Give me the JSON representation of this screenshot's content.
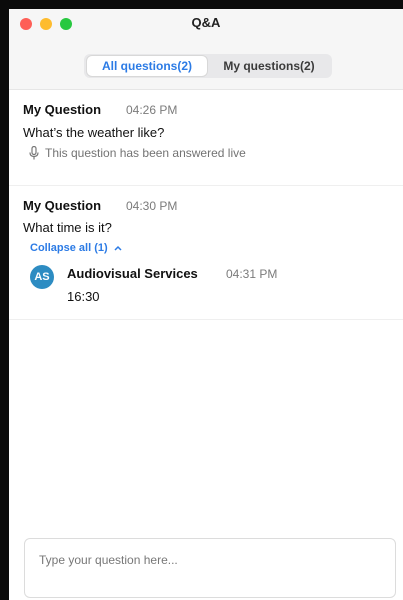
{
  "window": {
    "title": "Q&A"
  },
  "tabs": {
    "all": "All questions(2)",
    "mine": "My questions(2)"
  },
  "questions": [
    {
      "author": "My Question",
      "time": "04:26 PM",
      "text": "What’s the weather like?",
      "status": "This question has been answered live",
      "status_icon": "microphone-icon"
    },
    {
      "author": "My Question",
      "time": "04:30 PM",
      "text": "What time is it?",
      "collapse_label": "Collapse all (1)",
      "answer": {
        "avatar_initials": "AS",
        "responder": "Audiovisual Services",
        "time": "04:31 PM",
        "text": "16:30"
      }
    }
  ],
  "input": {
    "placeholder": "Type your question here..."
  },
  "colors": {
    "accent": "#2c7be5",
    "avatar": "#2d8cc2",
    "close": "#fe5f57",
    "minimize": "#febc2e",
    "maximize": "#28c840"
  }
}
